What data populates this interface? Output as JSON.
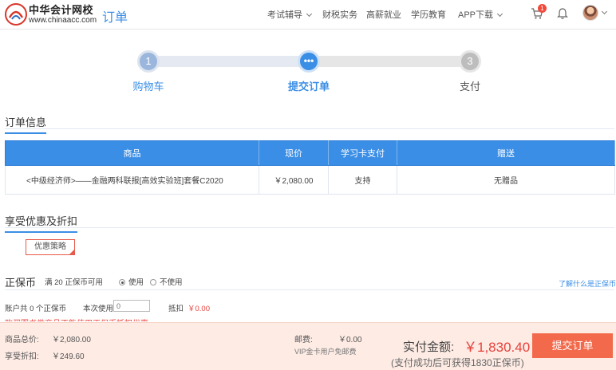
{
  "header": {
    "logo_cn": "中华会计网校",
    "logo_en": "www.chinaacc.com",
    "title": "订单",
    "nav": [
      {
        "label": "考试辅导",
        "dropdown": true
      },
      {
        "label": "财税实务",
        "dropdown": false
      },
      {
        "label": "高薪就业",
        "dropdown": false
      },
      {
        "label": "学历教育",
        "dropdown": false
      },
      {
        "label": "APP下载",
        "dropdown": true
      }
    ],
    "cart_badge": "1",
    "icons": [
      "cart-icon",
      "bell-icon",
      "avatar"
    ]
  },
  "steps": [
    {
      "number": "1",
      "label": "购物车",
      "state": "done"
    },
    {
      "number": "•••",
      "label": "提交订单",
      "state": "active"
    },
    {
      "number": "3",
      "label": "支付",
      "state": "pending"
    }
  ],
  "order_info": {
    "title": "订单信息",
    "columns": [
      "商品",
      "现价",
      "学习卡支付",
      "赠送"
    ],
    "rows": [
      [
        "<中级经济师>——金融两科联报[高效实验班]套餐C2020",
        "￥2,080.00",
        "支持",
        "无赠品"
      ]
    ]
  },
  "discount": {
    "title": "享受优惠及折扣",
    "promo_button": "优惠策略"
  },
  "zhengbaobi": {
    "title": "正保币",
    "rule": "满 20 正保币可用",
    "radio_use": "使用",
    "radio_no_use": "不使用",
    "selected": "使用",
    "help_link": "了解什么是正保币",
    "balance": "账户共 0 个正保币",
    "use_label": "本次使用:",
    "use_placeholder": "0",
    "deduct_label": "抵扣",
    "deduct_value": "￥0.00",
    "warning": "购买图书类商品不能使用正保币抵扣优惠"
  },
  "footer": {
    "goods_total_label": "商品总价:",
    "goods_total_value": "￥2,080.00",
    "discount_label": "享受折扣:",
    "discount_value": "￥249.60",
    "postage_label": "邮费:",
    "postage_value": "￥0.00",
    "postage_note": "VIP金卡用户免邮费",
    "paid_label": "实付金额:",
    "paid_value": "￥1,830.40",
    "reward_note": "(支付成功后可获得1830正保币)",
    "submit_label": "提交订单"
  },
  "colors": {
    "accent": "#3a8ee6",
    "danger": "#e8413b",
    "submit": "#f26a4b",
    "footer_bg": "#fdebe4"
  }
}
